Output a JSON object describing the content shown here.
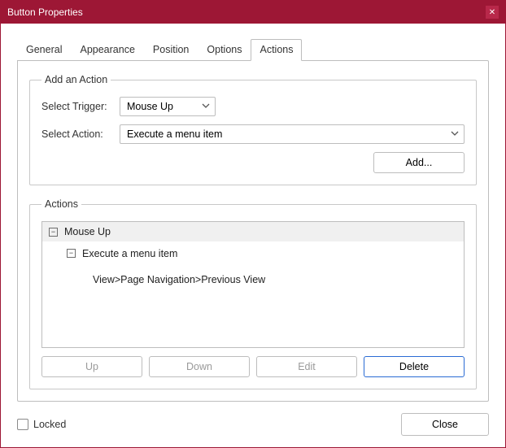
{
  "window": {
    "title": "Button Properties"
  },
  "tabs": {
    "general": "General",
    "appearance": "Appearance",
    "position": "Position",
    "options": "Options",
    "actions": "Actions",
    "active": "actions"
  },
  "addAction": {
    "legend": "Add an Action",
    "triggerLabel": "Select Trigger:",
    "triggerValue": "Mouse Up",
    "actionLabel": "Select Action:",
    "actionValue": "Execute a menu item",
    "addButton": "Add..."
  },
  "actions": {
    "legend": "Actions",
    "tree": {
      "root": "Mouse Up",
      "child": "Execute a menu item",
      "leaf": "View>Page Navigation>Previous View"
    },
    "buttons": {
      "up": "Up",
      "down": "Down",
      "edit": "Edit",
      "delete": "Delete"
    }
  },
  "footer": {
    "locked": "Locked",
    "close": "Close"
  }
}
